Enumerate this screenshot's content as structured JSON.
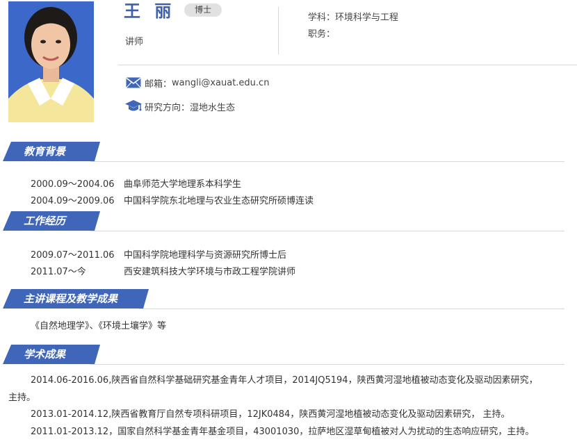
{
  "profile": {
    "name": "王 丽",
    "degree": "博士",
    "title": "讲师",
    "subject_label": "学科：",
    "subject": "环境科学与工程",
    "position_label": "职务：",
    "email_label": "邮箱：",
    "email": "wangli@xauat.edu.cn",
    "research_label": "研究方向：",
    "research": "湿地水生态"
  },
  "sections": {
    "education": {
      "title": "教育背景",
      "items": [
        {
          "date": "2000.09～2004.06",
          "text": "曲阜师范大学地理系本科学生"
        },
        {
          "date": "2004.09～2009.06",
          "text": "中国科学院东北地理与农业生态研究所硕博连读"
        }
      ]
    },
    "work": {
      "title": "工作经历",
      "items": [
        {
          "date": "2009.07～2011.06",
          "text": "中国科学院地理科学与资源研究所博士后"
        },
        {
          "date": "2011.07～今",
          "text": "西安建筑科技大学环境与市政工程学院讲师"
        }
      ]
    },
    "courses": {
      "title": "主讲课程及教学成果",
      "text": "《自然地理学》、《环境土壤学》等"
    },
    "research": {
      "title": "学术成果",
      "p1_line1": "2014.06-2016.06,陕西省自然科学基础研究基金青年人才项目，2014JQ5194，陕西黄河湿地植被动态变化及驱动因素研究，",
      "p1_line2": "主持。",
      "p2": "2013.01-2014.12,陕西省教育厅自然专项科研项目，12JK0484，陕西黄河湿地植被动态变化及驱动因素研究， 主持。",
      "p3": "2011.01-2013.12，国家自然科学基金青年基金项目，43001030，拉萨地区湿草甸植被对人为扰动的生态响应研究，主持。"
    }
  },
  "colors": {
    "accent": "#3f66b8",
    "name": "#3d5fae"
  }
}
